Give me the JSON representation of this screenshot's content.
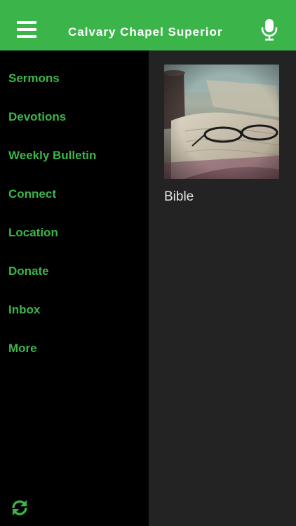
{
  "header": {
    "title": "Calvary Chapel Superior",
    "menu_icon": "hamburger-menu-icon",
    "mic_icon": "microphone-icon",
    "background_color": "#3bb54a"
  },
  "sidebar": {
    "items": [
      {
        "label": "Sermons"
      },
      {
        "label": "Devotions"
      },
      {
        "label": "Weekly Bulletin"
      },
      {
        "label": "Connect"
      },
      {
        "label": "Location"
      },
      {
        "label": "Donate"
      },
      {
        "label": "Inbox"
      },
      {
        "label": "More"
      }
    ],
    "text_color": "#3bb54a",
    "refresh_icon": "refresh-icon"
  },
  "content": {
    "cards": [
      {
        "label": "Bible",
        "image": "open-bible-with-reading-glasses-photo"
      }
    ]
  }
}
